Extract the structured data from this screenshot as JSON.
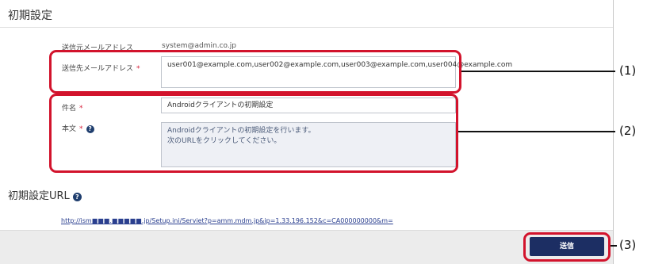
{
  "page": {
    "title": "初期設定"
  },
  "form": {
    "sender": {
      "label": "送信元メールアドレス",
      "value": "system@admin.co.jp"
    },
    "recipients": {
      "label": "送信先メールアドレス",
      "required_mark": "*",
      "value": "user001@example.com,user002@example.com,user003@example.com,user004@example.com"
    },
    "subject": {
      "label": "件名",
      "required_mark": "*",
      "value": "Androidクライアントの初期設定"
    },
    "body": {
      "label": "本文",
      "required_mark": "*",
      "help": "?",
      "value": "Androidクライアントの初期設定を行います。\n次のURLをクリックしてください。"
    }
  },
  "url_section": {
    "title": "初期設定URL",
    "help": "?",
    "link": "http://ism■■■.■■■■■.jp/Setup.ini/Serviet?p=amm.mdm.jp&ip=1.33.196.152&c=CA000000000&m="
  },
  "footer": {
    "send_label": "送信"
  },
  "callouts": [
    "(1)",
    "(2)",
    "(3)"
  ],
  "colors": {
    "accent_red": "#d2132c",
    "button_navy": "#1c2e63",
    "required": "#d6203a"
  }
}
